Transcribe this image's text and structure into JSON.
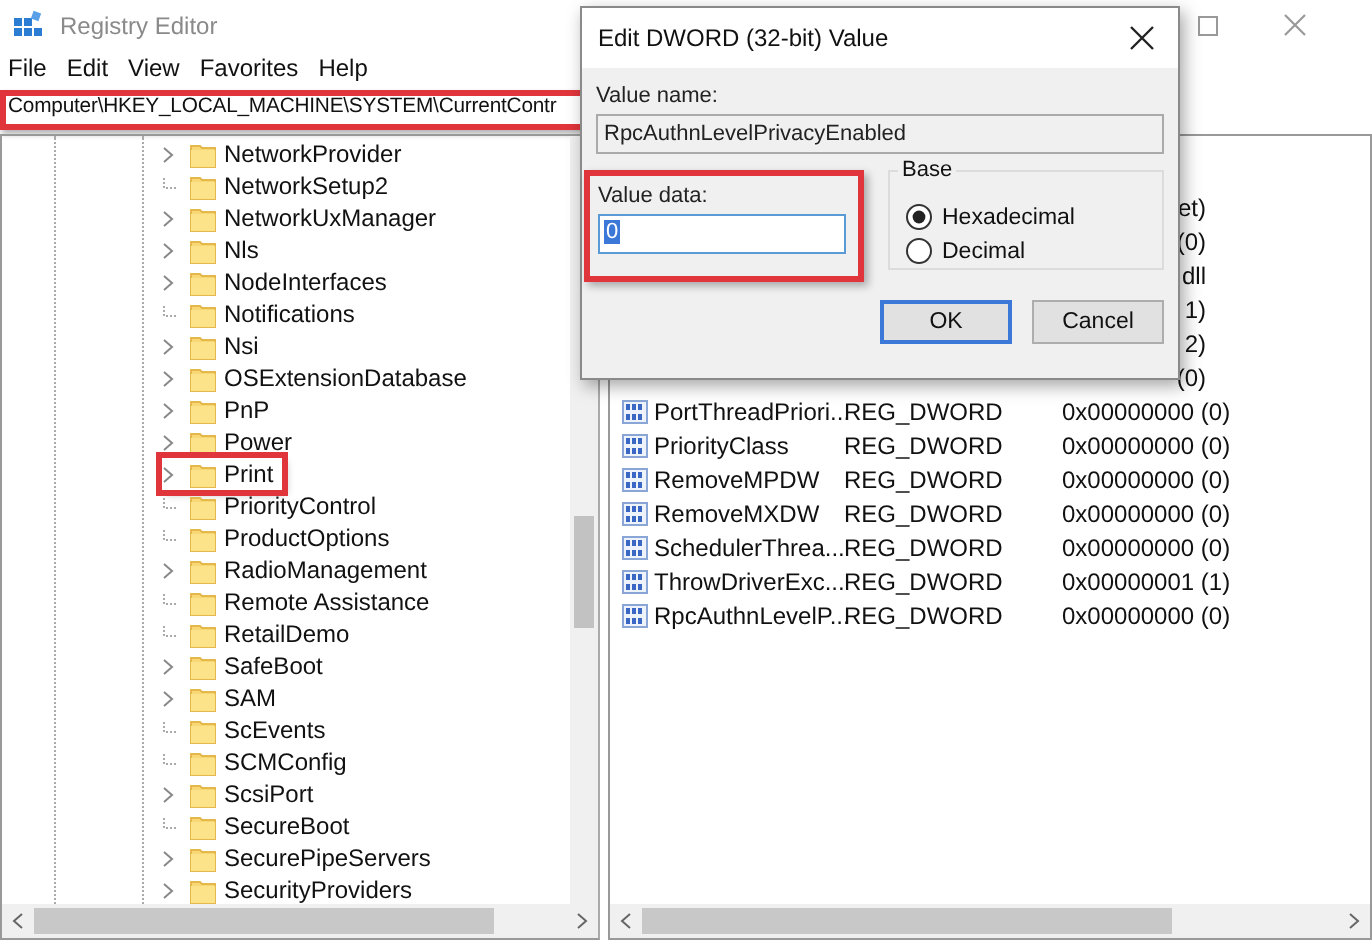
{
  "window": {
    "title": "Registry Editor"
  },
  "menu": [
    "File",
    "Edit",
    "View",
    "Favorites",
    "Help"
  ],
  "address_bar": {
    "value": "Computer\\HKEY_LOCAL_MACHINE\\SYSTEM\\CurrentContr",
    "highlighted": true
  },
  "tree": {
    "items": [
      {
        "label": "NetworkProvider",
        "expandable": true,
        "highlighted": false
      },
      {
        "label": "NetworkSetup2",
        "expandable": false,
        "highlighted": false
      },
      {
        "label": "NetworkUxManager",
        "expandable": true,
        "highlighted": false
      },
      {
        "label": "Nls",
        "expandable": true,
        "highlighted": false
      },
      {
        "label": "NodeInterfaces",
        "expandable": true,
        "highlighted": false
      },
      {
        "label": "Notifications",
        "expandable": false,
        "highlighted": false
      },
      {
        "label": "Nsi",
        "expandable": true,
        "highlighted": false
      },
      {
        "label": "OSExtensionDatabase",
        "expandable": true,
        "highlighted": false
      },
      {
        "label": "PnP",
        "expandable": true,
        "highlighted": false
      },
      {
        "label": "Power",
        "expandable": true,
        "highlighted": false
      },
      {
        "label": "Print",
        "expandable": true,
        "highlighted": true
      },
      {
        "label": "PriorityControl",
        "expandable": false,
        "highlighted": false
      },
      {
        "label": "ProductOptions",
        "expandable": false,
        "highlighted": false
      },
      {
        "label": "RadioManagement",
        "expandable": true,
        "highlighted": false
      },
      {
        "label": "Remote Assistance",
        "expandable": false,
        "highlighted": false
      },
      {
        "label": "RetailDemo",
        "expandable": false,
        "highlighted": false
      },
      {
        "label": "SafeBoot",
        "expandable": true,
        "highlighted": false
      },
      {
        "label": "SAM",
        "expandable": true,
        "highlighted": false
      },
      {
        "label": "ScEvents",
        "expandable": false,
        "highlighted": false
      },
      {
        "label": "SCMConfig",
        "expandable": false,
        "highlighted": false
      },
      {
        "label": "ScsiPort",
        "expandable": true,
        "highlighted": false
      },
      {
        "label": "SecureBoot",
        "expandable": false,
        "highlighted": false
      },
      {
        "label": "SecurePipeServers",
        "expandable": true,
        "highlighted": false
      },
      {
        "label": "SecurityProviders",
        "expandable": true,
        "highlighted": false
      }
    ]
  },
  "values": {
    "rows": [
      {
        "kind": "partial",
        "data": "et)"
      },
      {
        "kind": "partial",
        "data": "(0)"
      },
      {
        "kind": "partial",
        "data": "dll"
      },
      {
        "kind": "partial",
        "data": "1)"
      },
      {
        "kind": "partial",
        "data": "2)"
      },
      {
        "kind": "partial",
        "data": "(0)"
      },
      {
        "kind": "full",
        "name": "PortThreadPriori...",
        "type": "REG_DWORD",
        "data": "0x00000000 (0)"
      },
      {
        "kind": "full",
        "name": "PriorityClass",
        "type": "REG_DWORD",
        "data": "0x00000000 (0)"
      },
      {
        "kind": "full",
        "name": "RemoveMPDW",
        "type": "REG_DWORD",
        "data": "0x00000000 (0)"
      },
      {
        "kind": "full",
        "name": "RemoveMXDW",
        "type": "REG_DWORD",
        "data": "0x00000000 (0)"
      },
      {
        "kind": "full",
        "name": "SchedulerThrea...",
        "type": "REG_DWORD",
        "data": "0x00000000 (0)"
      },
      {
        "kind": "full",
        "name": "ThrowDriverExc...",
        "type": "REG_DWORD",
        "data": "0x00000001 (1)"
      },
      {
        "kind": "full",
        "name": "RpcAuthnLevelP...",
        "type": "REG_DWORD",
        "data": "0x00000000 (0)"
      }
    ]
  },
  "dialog": {
    "title": "Edit DWORD (32-bit) Value",
    "value_name_label": "Value name:",
    "value_name": "RpcAuthnLevelPrivacyEnabled",
    "value_data_label": "Value data:",
    "value_data": "0",
    "value_data_highlighted": true,
    "base_label": "Base",
    "base_options": [
      {
        "label": "Hexadecimal",
        "selected": true
      },
      {
        "label": "Decimal",
        "selected": false
      }
    ],
    "buttons": [
      {
        "label": "OK",
        "default": true
      },
      {
        "label": "Cancel",
        "default": false
      }
    ]
  }
}
